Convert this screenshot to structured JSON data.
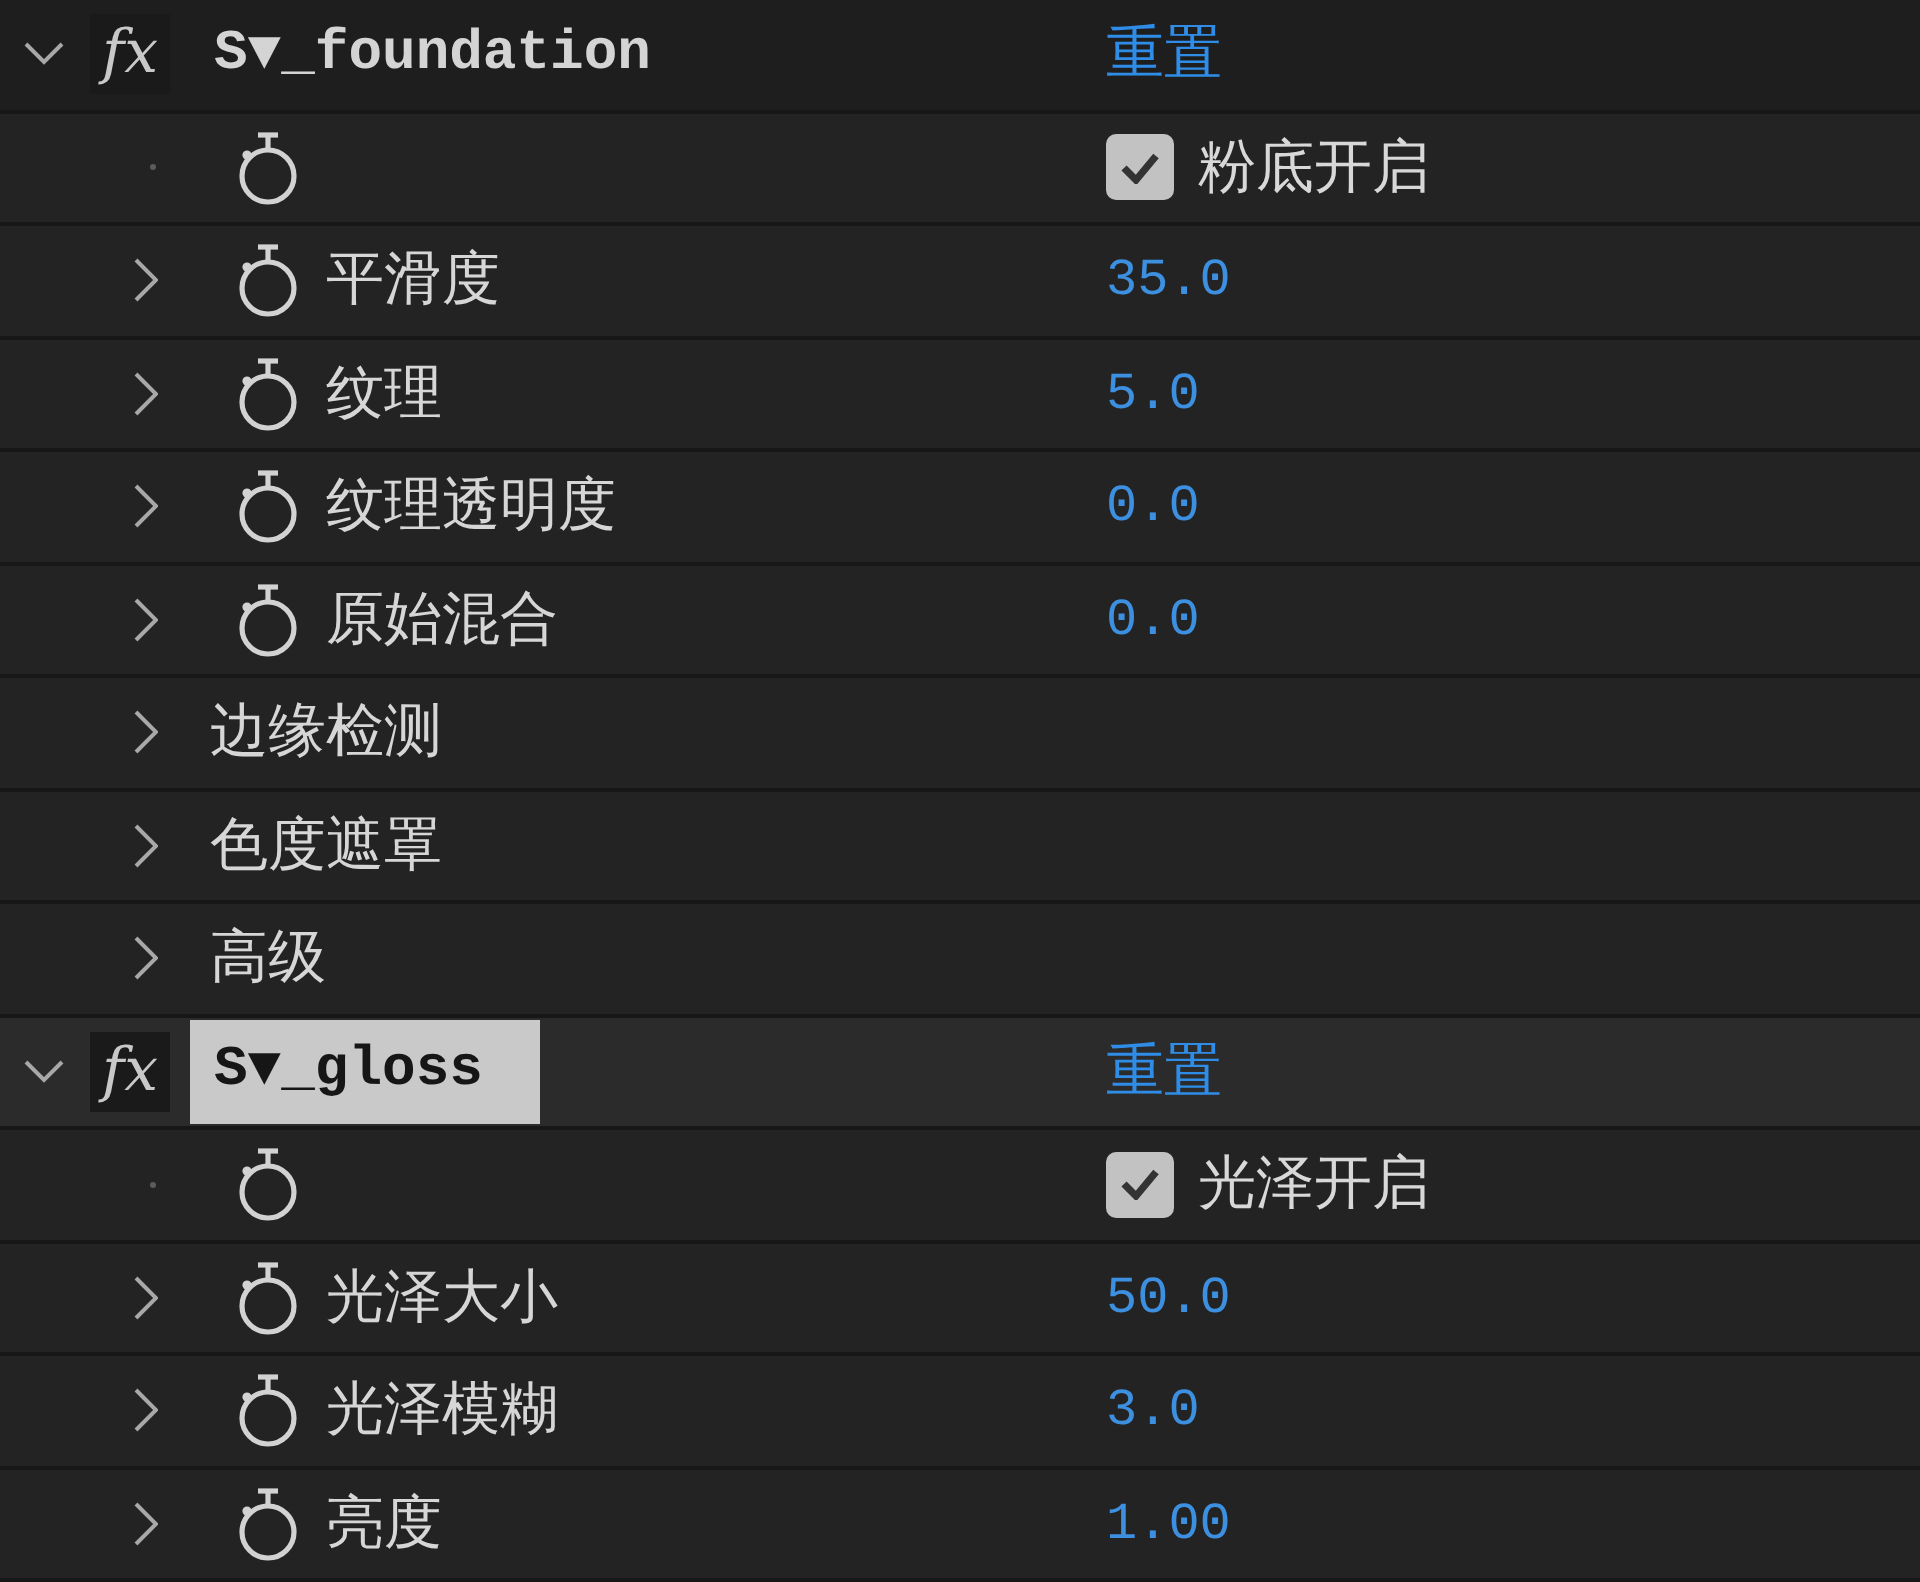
{
  "effects": [
    {
      "name": "S▼_foundation",
      "icon_text": "fx",
      "selected": false,
      "expanded": true,
      "reset": "重置",
      "properties": [
        {
          "kind": "checkbox",
          "label": "粉底开启",
          "checked": true
        },
        {
          "kind": "value",
          "label": "平滑度",
          "value": "35.0",
          "expanded": false
        },
        {
          "kind": "value",
          "label": "纹理",
          "value": "5.0",
          "expanded": false
        },
        {
          "kind": "value",
          "label": "纹理透明度",
          "value": "0.0",
          "expanded": false
        },
        {
          "kind": "value",
          "label": "原始混合",
          "value": "0.0",
          "expanded": false
        },
        {
          "kind": "group",
          "label": "边缘检测",
          "expanded": false
        },
        {
          "kind": "group",
          "label": "色度遮罩",
          "expanded": false
        },
        {
          "kind": "group",
          "label": "高级",
          "expanded": false
        }
      ]
    },
    {
      "name": "S▼_gloss",
      "icon_text": "fx",
      "selected": true,
      "expanded": true,
      "reset": "重置",
      "properties": [
        {
          "kind": "checkbox",
          "label": "光泽开启",
          "checked": true
        },
        {
          "kind": "value",
          "label": "光泽大小",
          "value": "50.0",
          "expanded": false
        },
        {
          "kind": "value",
          "label": "光泽模糊",
          "value": "3.0",
          "expanded": false
        },
        {
          "kind": "value",
          "label": "亮度",
          "value": "1.00",
          "expanded": false
        }
      ]
    }
  ]
}
